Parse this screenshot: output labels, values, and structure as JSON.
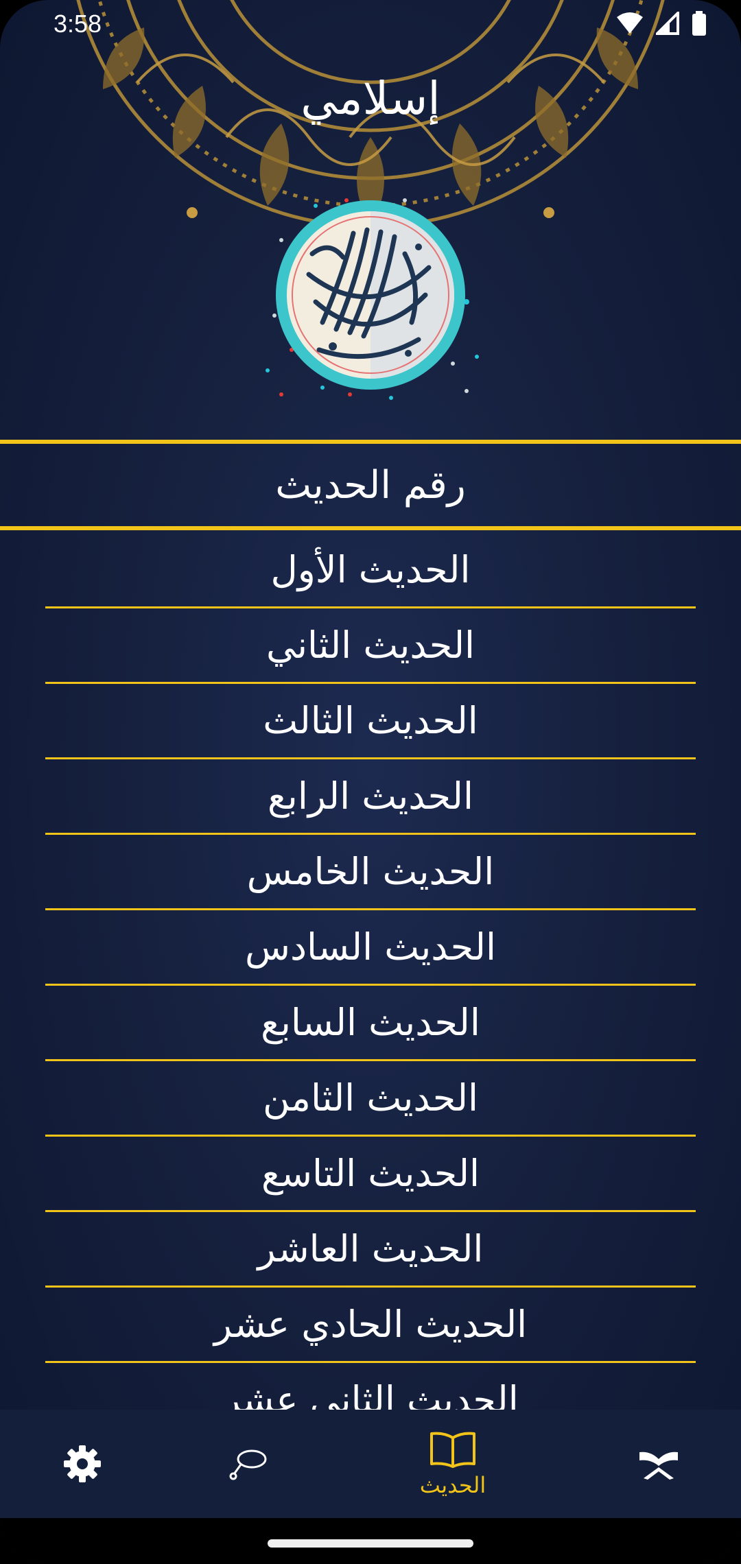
{
  "status_bar": {
    "time": "3:58",
    "icons": [
      "wifi-icon",
      "signal-icon",
      "battery-icon"
    ]
  },
  "header": {
    "app_title": "إسلامي",
    "emblem": "basmala-calligraphy-emblem"
  },
  "section": {
    "title": "رقم الحديث"
  },
  "hadith_list": [
    "الحديث الأول",
    "الحديث الثاني",
    "الحديث الثالث",
    "الحديث الرابع",
    "الحديث الخامس",
    "الحديث السادس",
    "الحديث السابع",
    "الحديث الثامن",
    "الحديث التاسع",
    "الحديث العاشر",
    "الحديث الحادي عشر",
    "الحديث الثاني عشر"
  ],
  "bottom_nav": {
    "items": [
      {
        "icon": "gear-icon",
        "label": "",
        "active": false
      },
      {
        "icon": "tasbeeh-icon",
        "label": "",
        "active": false
      },
      {
        "icon": "book-icon",
        "label": "الحديث",
        "active": true
      },
      {
        "icon": "quran-icon",
        "label": "",
        "active": false
      }
    ]
  },
  "colors": {
    "accent": "#f2c318",
    "background": "#16213f",
    "nav_background": "#141f3b",
    "text": "#ffffff",
    "inactive_icon": "#ffffff"
  }
}
